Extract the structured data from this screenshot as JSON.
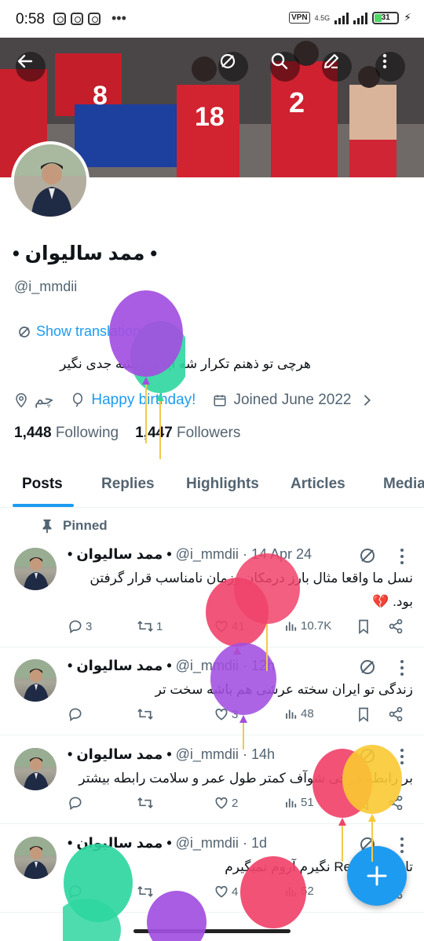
{
  "status": {
    "time": "0:58",
    "network": "4.5G",
    "vpn": "VPN",
    "battery": "31"
  },
  "profile": {
    "name": "• ممد سالیوان •",
    "handle": "@i_mmdii",
    "translate": "Show translation",
    "bio": "هرچی تو ذهنم تکرار شه اپلای میشه جدی نگیر",
    "location": "چم",
    "birthday": "Happy birthday!",
    "joined": "Joined June 2022",
    "following_count": "1,448",
    "following_label": "Following",
    "followers_count": "1,447",
    "followers_label": "Followers"
  },
  "tabs": [
    "Posts",
    "Replies",
    "Highlights",
    "Articles",
    "Media"
  ],
  "pinned_label": "Pinned",
  "tweets": [
    {
      "name": "• ممد سالیوان •",
      "handle": "@i_mmdii",
      "time": "14 Apr 24",
      "text": "نسل ما واقعا مثال بارز درمکان وزمان نامناسب قرار گرفتن بود. 💔",
      "replies": "3",
      "retweets": "1",
      "likes": "41",
      "views": "10.7K"
    },
    {
      "name": "• ممد سالیوان •",
      "handle": "@i_mmdii",
      "time": "12h",
      "text": "زندگی تو ایران سخته عرشی هم باشه سخت تر",
      "replies": "",
      "retweets": "",
      "likes": "3",
      "views": "48"
    },
    {
      "name": "• ممد سالیوان •",
      "handle": "@i_mmdii",
      "time": "14h",
      "text": "بر رابطه هرچی شوآف کمتر طول عمر و سلامت رابطه بیشتر",
      "replies": "",
      "retweets": "",
      "likes": "2",
      "views": "51"
    },
    {
      "name": "• ممد سالیوان •",
      "handle": "@i_mmdii",
      "time": "1d",
      "text": "تا Repsol 100 نگیرم آروم نمیگیرم",
      "replies": "",
      "retweets": "",
      "likes": "4",
      "views": "52"
    }
  ],
  "colors": {
    "accent": "#1d9bf0",
    "text": "#0f1419",
    "muted": "#536471",
    "heart": "#e0245e"
  },
  "icons": [
    "back-arrow-icon",
    "grok-icon",
    "search-icon",
    "edit-icon",
    "more-vert-icon",
    "translate-icon",
    "location-icon",
    "balloon-icon",
    "calendar-icon",
    "chevron-right-icon",
    "pin-icon",
    "reply-icon",
    "retweet-icon",
    "like-icon",
    "views-icon",
    "bookmark-icon",
    "share-icon",
    "plus-icon"
  ]
}
